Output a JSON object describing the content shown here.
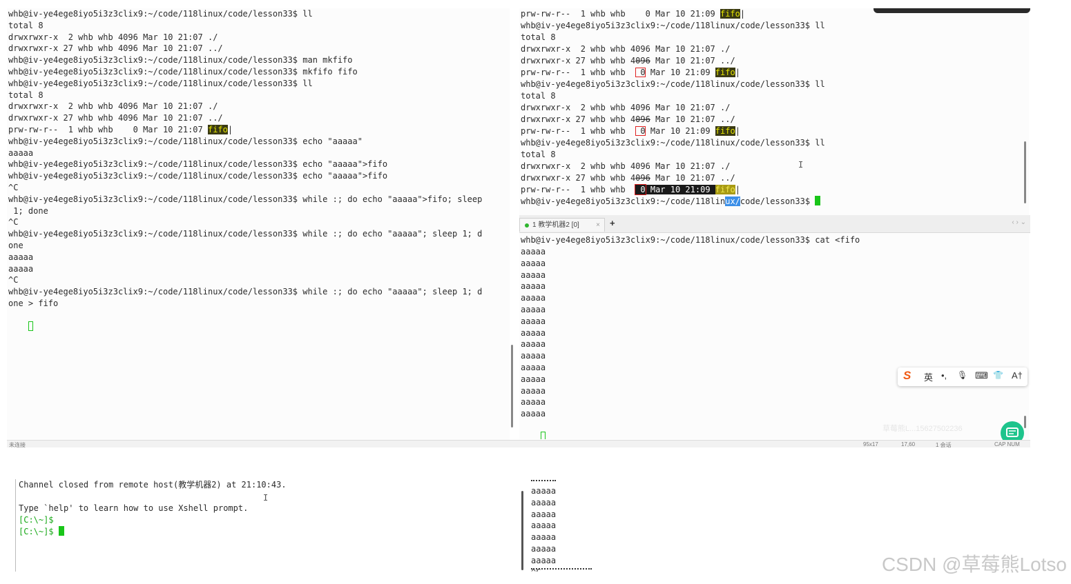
{
  "left_terminal": {
    "lines": [
      "whb@iv-ye4ege8iyo5i3z3clix9:~/code/118linux/code/lesson33$ ll",
      "total 8",
      "drwxrwxr-x  2 whb whb 4096 Mar 10 21:07 ./",
      "drwxrwxr-x 27 whb whb 4096 Mar 10 21:07 ../",
      "whb@iv-ye4ege8iyo5i3z3clix9:~/code/118linux/code/lesson33$ man mkfifo",
      "whb@iv-ye4ege8iyo5i3z3clix9:~/code/118linux/code/lesson33$ mkfifo fifo",
      "whb@iv-ye4ege8iyo5i3z3clix9:~/code/118linux/code/lesson33$ ll",
      "total 8",
      "drwxrwxr-x  2 whb whb 4096 Mar 10 21:07 ./",
      "drwxrwxr-x 27 whb whb 4096 Mar 10 21:07 ../",
      "prw-rw-r--  1 whb whb    0 Mar 10 21:07 ",
      "whb@iv-ye4ege8iyo5i3z3clix9:~/code/118linux/code/lesson33$ echo \"aaaaa\"",
      "aaaaa",
      "whb@iv-ye4ege8iyo5i3z3clix9:~/code/118linux/code/lesson33$ echo \"aaaaa\">fifo",
      "whb@iv-ye4ege8iyo5i3z3clix9:~/code/118linux/code/lesson33$ echo \"aaaaa\">fifo",
      "^C",
      "whb@iv-ye4ege8iyo5i3z3clix9:~/code/118linux/code/lesson33$ while :; do echo \"aaaaa\">fifo; sleep",
      " 1; done",
      "^C",
      "whb@iv-ye4ege8iyo5i3z3clix9:~/code/118linux/code/lesson33$ while :; do echo \"aaaaa\"; sleep 1; d",
      "one",
      "aaaaa",
      "aaaaa",
      "^C",
      "whb@iv-ye4ege8iyo5i3z3clix9:~/code/118linux/code/lesson33$ while :; do echo \"aaaaa\"; sleep 1; d",
      "one > fifo"
    ],
    "fifo_label": "fifo"
  },
  "right_top_terminal": {
    "line0_prefix": "prw-rw-r--  1 whb whb    0 Mar 10 21:09 ",
    "prompt_ll": "whb@iv-ye4ege8iyo5i3z3clix9:~/code/118linux/code/lesson33$ ll",
    "total": "total 8",
    "dir_self": "drwxrwxr-x  2 whb whb 4096 Mar 10 21:07 ./",
    "dir_parent_a": "drwxrwxr-x 27 whb whb 4",
    "dir_parent_b": "096",
    "dir_parent_c": " Mar 10 21:07 ../",
    "pipe_prefix": "prw-rw-r--  1 whb whb  ",
    "pipe_size": " 0",
    "pipe_date": " Mar 10 21:09 ",
    "pipe_date_highlight": " Mar 10 21:09 ",
    "fifo_label": "fifo",
    "final_prompt_a": "whb@iv-ye4ege8iyo5i3z3clix9:~/code/118lin",
    "final_prompt_sel": "ux/",
    "final_prompt_b": "code/lesson33$ "
  },
  "tab": {
    "label": "1 教学机器2 [0]",
    "close": "×",
    "add": "+",
    "nav": "‹ › ⌄"
  },
  "right_bottom_terminal": {
    "command": "whb@iv-ye4ege8iyo5i3z3clix9:~/code/118linux/code/lesson33$ cat <fifo",
    "output_line": "aaaaa",
    "output_count": 15
  },
  "status_bar": {
    "left": "未连接",
    "size": "95x17",
    "pos": "17,60",
    "sessions": "1 会话",
    "caps": "CAP  NUM"
  },
  "ime_toolbar": {
    "logo": "S",
    "lang": "英",
    "punct": "•,",
    "mic": "🎙",
    "keyboard": "⌨",
    "skin": "👕",
    "tools": "A†"
  },
  "bottom_left_terminal": {
    "lines": [
      "Channel closed from remote host(教学机器2) at 21:10:43.",
      "",
      "Type `help' to learn how to use Xshell prompt.",
      "[C:\\~]$",
      "[C:\\~]$ "
    ]
  },
  "bottom_right_terminal": {
    "lines": [
      "aaaaa",
      "aaaaa",
      "aaaaa",
      "aaaaa",
      "aaaaa",
      "aaaaa",
      "aaaaa",
      "^C"
    ]
  },
  "overlay_text": {
    "ghost_name": "草莓熊L...15627502236"
  },
  "watermark": "CSDN @草莓熊Lotso",
  "colors": {
    "fifo_bg": "#3a3a14",
    "fifo_fg": "#e5e500",
    "cursor": "#19c519",
    "red_box": "#e02020",
    "selection": "#3b8fe8",
    "chat_button": "#1ec48c"
  }
}
